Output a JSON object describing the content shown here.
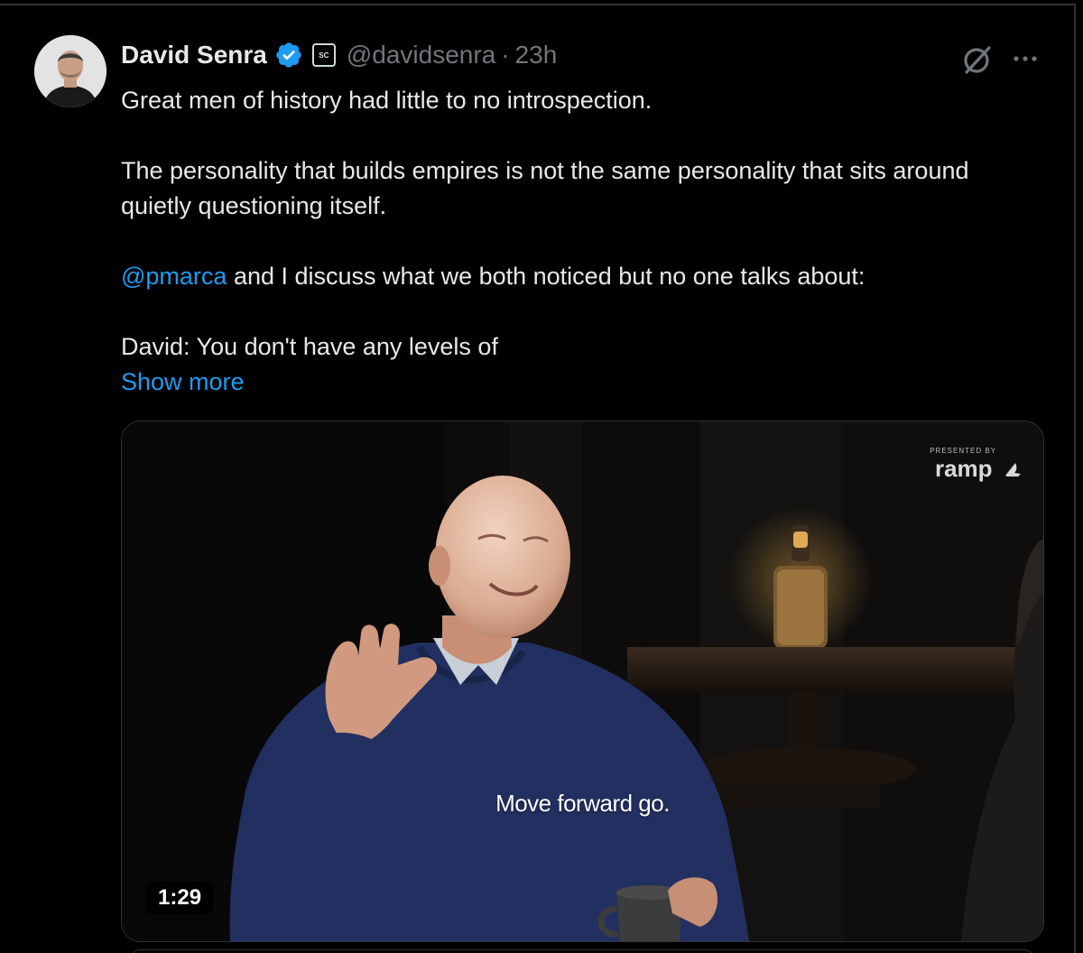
{
  "tweet": {
    "author": {
      "display_name": "David Senra",
      "handle": "@davidsenra",
      "verified": true,
      "affiliate_badge_text": "SC"
    },
    "separator": "·",
    "timestamp": "23h",
    "icons": {
      "grok": "grok-icon",
      "more": "more-options-icon"
    },
    "body": {
      "line1": "Great men of history had little to no introspection.",
      "line2": "The personality that builds empires is not the same personality that sits around quietly questioning itself.",
      "mention": "@pmarca",
      "line3_rest": " and I discuss what we both noticed but no one talks about:",
      "line4": "David: You don't have any levels of",
      "show_more": "Show more"
    },
    "video": {
      "sponsor_label": "PRESENTED BY",
      "sponsor_brand": "ramp",
      "caption": "Move forward go.",
      "duration": "1:29"
    }
  },
  "colors": {
    "background": "#000000",
    "text_primary": "#e7e9ea",
    "text_secondary": "#71767b",
    "link": "#1d9bf0",
    "verified_badge": "#1d9bf0",
    "border": "#2f3336"
  }
}
